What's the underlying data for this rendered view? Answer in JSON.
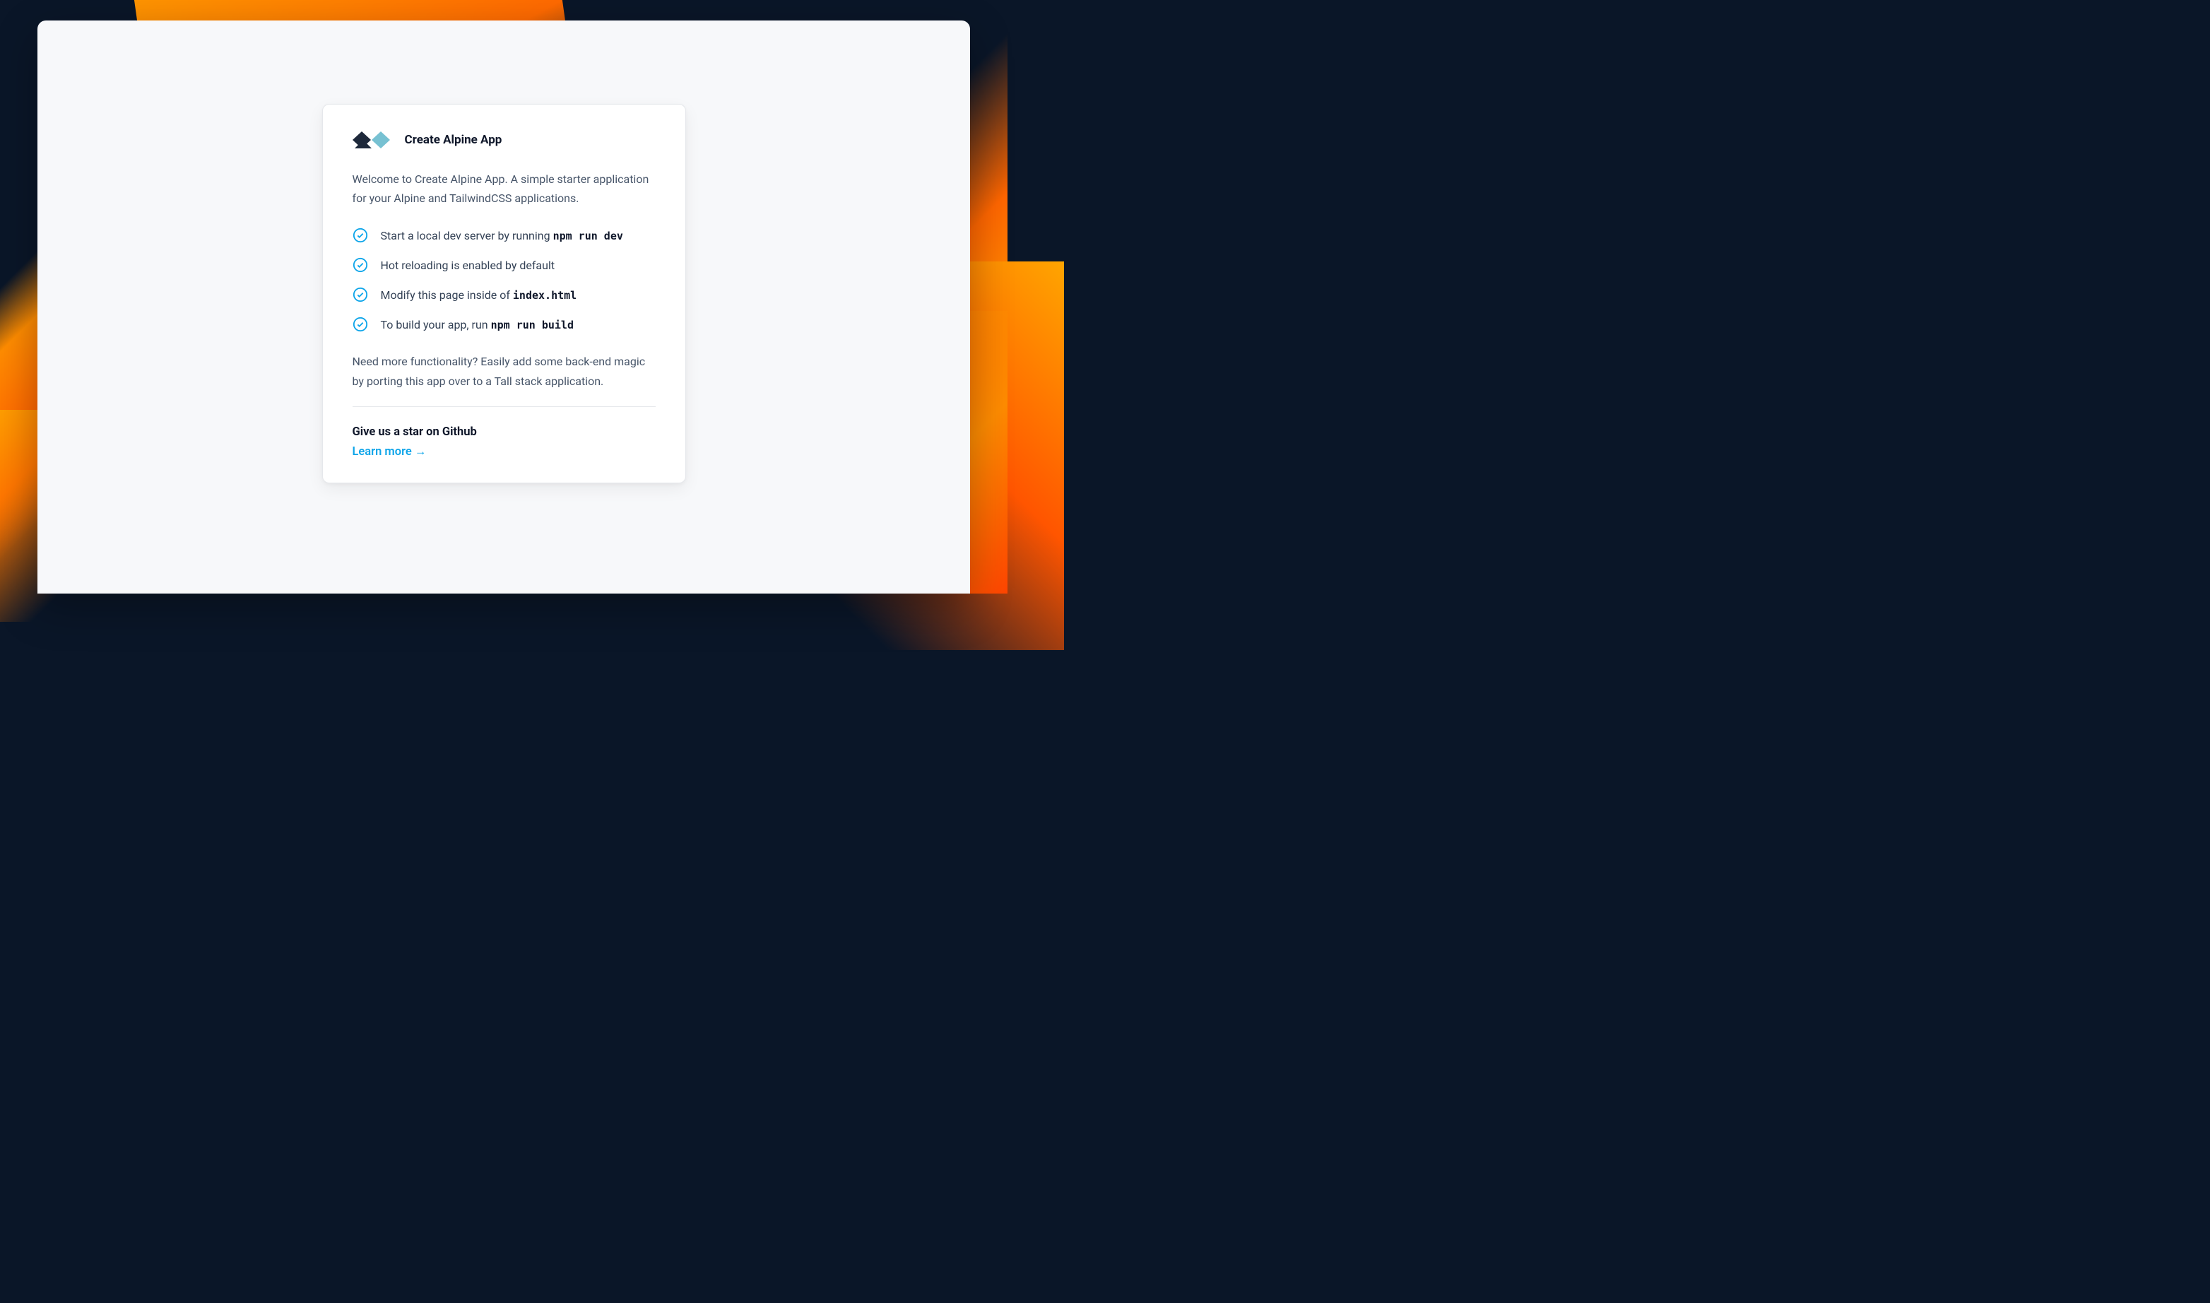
{
  "header": {
    "title": "Create Alpine App"
  },
  "intro": "Welcome to Create Alpine App. A simple starter application for your Alpine and TailwindCSS applications.",
  "checklist": [
    {
      "text": "Start a local dev server by running ",
      "code": "npm run dev"
    },
    {
      "text": "Hot reloading is enabled by default",
      "code": ""
    },
    {
      "text": "Modify this page inside of ",
      "code": "index.html"
    },
    {
      "text": "To build your app, run ",
      "code": "npm run build"
    }
  ],
  "footer_text": "Need more functionality? Easily add some back-end magic by porting this app over to a Tall stack application.",
  "cta": {
    "title": "Give us a star on Github",
    "link_text": "Learn more →"
  },
  "colors": {
    "accent": "#0ea5e9",
    "logo_dark": "#1e293b",
    "logo_light": "#77c1d2"
  }
}
